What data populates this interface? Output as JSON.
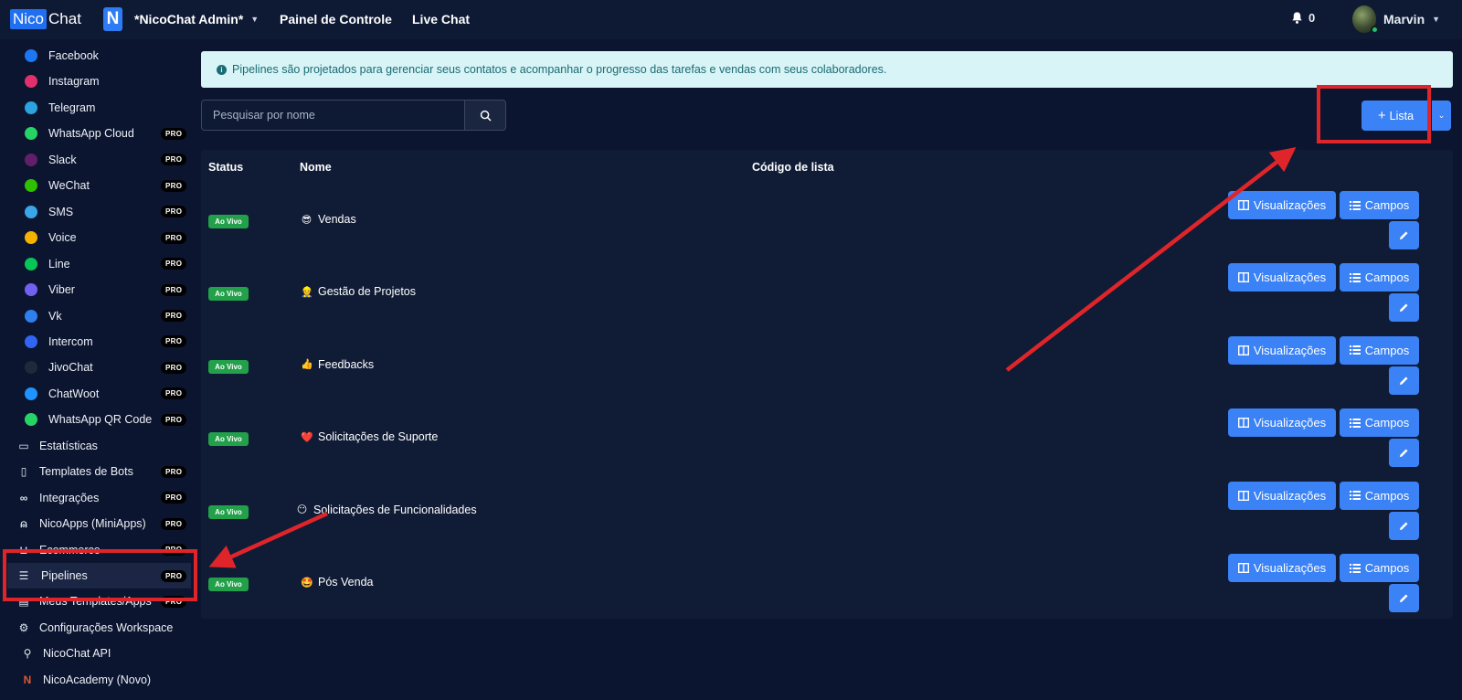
{
  "topbar": {
    "logo_part1": "Nico",
    "logo_part2": "Chat",
    "workspace_badge": "N",
    "workspace_name": "*NicoChat Admin*",
    "nav_dashboard": "Painel de Controle",
    "nav_livechat": "Live Chat",
    "notifications_count": "0",
    "user_name": "Marvin"
  },
  "sidebar": {
    "channels": [
      {
        "label": "Facebook",
        "icon": "facebook-icon",
        "color": "#1d77f2",
        "pro": false
      },
      {
        "label": "Instagram",
        "icon": "instagram-icon",
        "color": "#e1306c",
        "pro": false
      },
      {
        "label": "Telegram",
        "icon": "telegram-icon",
        "color": "#2aa3de",
        "pro": false
      },
      {
        "label": "WhatsApp Cloud",
        "icon": "whatsapp-icon",
        "color": "#25d366",
        "pro": true
      },
      {
        "label": "Slack",
        "icon": "slack-icon",
        "color": "#611f69",
        "pro": true
      },
      {
        "label": "WeChat",
        "icon": "wechat-icon",
        "color": "#2dc100",
        "pro": true
      },
      {
        "label": "SMS",
        "icon": "sms-icon",
        "color": "#3aa6e8",
        "pro": true
      },
      {
        "label": "Voice",
        "icon": "voice-icon",
        "color": "#f5b300",
        "pro": true
      },
      {
        "label": "Line",
        "icon": "line-icon",
        "color": "#06c755",
        "pro": true
      },
      {
        "label": "Viber",
        "icon": "viber-icon",
        "color": "#7360f2",
        "pro": true
      },
      {
        "label": "Vk",
        "icon": "vk-icon",
        "color": "#2f80ed",
        "pro": true
      },
      {
        "label": "Intercom",
        "icon": "intercom-icon",
        "color": "#3165f5",
        "pro": true
      },
      {
        "label": "JivoChat",
        "icon": "jivochat-icon",
        "color": "#1f2937",
        "pro": true
      },
      {
        "label": "ChatWoot",
        "icon": "chatwoot-icon",
        "color": "#1f93ff",
        "pro": true
      },
      {
        "label": "WhatsApp QR Code",
        "icon": "whatsapp-icon",
        "color": "#25d366",
        "pro": true
      }
    ],
    "menu": [
      {
        "label": "Estatísticas",
        "icon": "presentation-chart-icon",
        "pro": false
      },
      {
        "label": "Templates de Bots",
        "icon": "bookmark-icon",
        "pro": true
      },
      {
        "label": "Integrações",
        "icon": "link-icon",
        "pro": true
      },
      {
        "label": "NicoApps (MiniApps)",
        "icon": "user-icon",
        "pro": true
      },
      {
        "label": "Ecommerce",
        "icon": "cart-icon",
        "pro": true
      },
      {
        "label": "Pipelines",
        "icon": "checklist-icon",
        "pro": true,
        "active": true
      },
      {
        "label": "Meus Templates/Apps",
        "icon": "document-icon",
        "pro": true
      },
      {
        "label": "Configurações Workspace",
        "icon": "gear-icon",
        "pro": false
      },
      {
        "label": "NicoChat API",
        "icon": "api-icon",
        "pro": false
      },
      {
        "label": "NicoAcademy (Novo)",
        "icon": "nicoacademy-icon",
        "pro": false
      }
    ],
    "pro_label": "PRO"
  },
  "main": {
    "info_text": "Pipelines são projetados para gerenciar seus contatos e acompanhar o progresso das tarefas e vendas com seus colaboradores.",
    "search_placeholder": "Pesquisar por nome",
    "add_list_label": "Lista",
    "table": {
      "headers": {
        "status": "Status",
        "name": "Nome",
        "code": "Código de lista"
      },
      "rows": [
        {
          "status": "Ao Vivo",
          "emoji": "😎",
          "name": "Vendas"
        },
        {
          "status": "Ao Vivo",
          "emoji": "👷",
          "name": "Gestão de Projetos"
        },
        {
          "status": "Ao Vivo",
          "emoji": "👍",
          "name": "Feedbacks"
        },
        {
          "status": "Ao Vivo",
          "emoji": "❤️",
          "name": "Solicitações de Suporte"
        },
        {
          "status": "Ao Vivo",
          "emoji": "😶",
          "name": "Solicitações de Funcionalidades"
        },
        {
          "status": "Ao Vivo",
          "emoji": "🤩",
          "name": "Pós Venda"
        }
      ],
      "view_button_label": "Visualizações",
      "fields_button_label": "Campos"
    }
  },
  "colors": {
    "accent": "#3b82f6",
    "live_badge": "#22a04a",
    "annotation": "#e0252a"
  }
}
